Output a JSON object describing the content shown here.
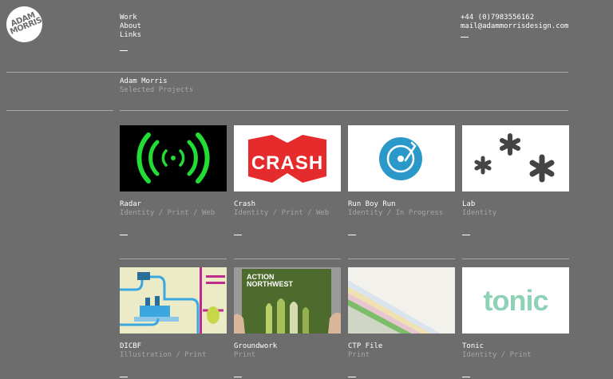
{
  "logo": {
    "text_line1": "ADAM",
    "text_line2": "MORRIS"
  },
  "nav": {
    "items": [
      {
        "label": "Work"
      },
      {
        "label": "About"
      },
      {
        "label": "Links"
      }
    ]
  },
  "contact": {
    "phone": "+44 (0)7983556162",
    "email": "mail@adammorrisdesign.com"
  },
  "intro": {
    "title": "Adam Morris",
    "subtitle": "Selected Projects"
  },
  "projects": [
    {
      "name": "Radar",
      "categories": "Identity / Print / Web"
    },
    {
      "name": "Crash",
      "categories": "Identity / Print / Web",
      "thumb_text": "CRASH"
    },
    {
      "name": "Run Boy Run",
      "categories": "Identity / In Progress"
    },
    {
      "name": "Lab",
      "categories": "Identity"
    },
    {
      "name": "DICBF",
      "categories": "Illustration / Print"
    },
    {
      "name": "Groundwork",
      "categories": "Print",
      "thumb_text_1": "ACTION",
      "thumb_text_2": "NORTHWEST"
    },
    {
      "name": "CTP File",
      "categories": "Print"
    },
    {
      "name": "Tonic",
      "categories": "Identity / Print",
      "thumb_text": "tonic"
    }
  ],
  "colors": {
    "background": "#6d6d6d",
    "radar_green": "#22dd33",
    "crash_red": "#e52b2b",
    "runboyrun_blue": "#2a99c9",
    "tonic_green": "#8ed1b7"
  }
}
